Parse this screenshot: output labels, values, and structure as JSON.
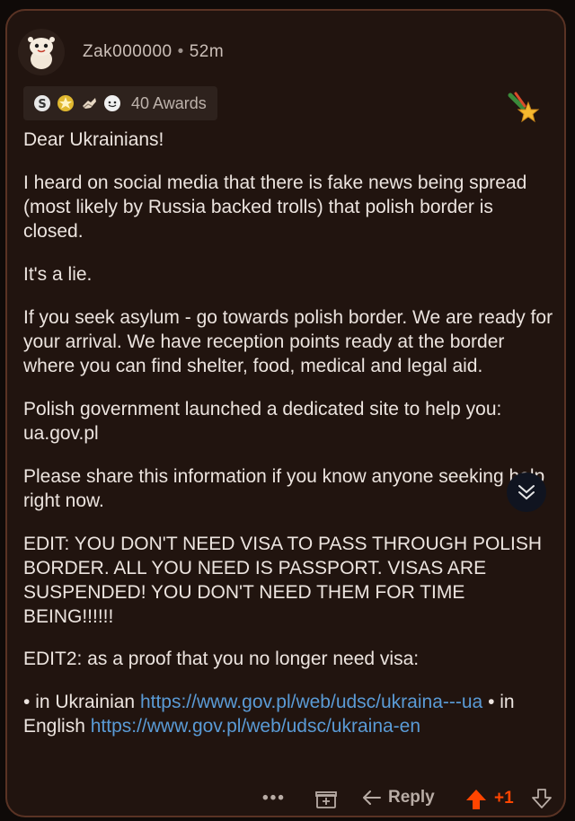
{
  "comment": {
    "username": "Zak000000",
    "separator": "•",
    "time": "52m",
    "awards_label": "40 Awards",
    "paragraphs": [
      "Dear Ukrainians!",
      "I heard on social media that there is fake news being spread (most likely by Russia backed trolls) that polish border is closed.",
      "It's a lie.",
      "If you seek asylum - go towards polish border. We are ready for your arrival. We have reception points ready at the border where you can find shelter, food, medical and legal aid.",
      "Polish government launched a dedicated site to help you: ua.gov.pl",
      "Please share this information if you know anyone seeking help right now.",
      "EDIT: YOU DON'T NEED VISA TO PASS THROUGH POLISH BORDER. ALL YOU NEED IS PASSPORT. VISAS ARE SUSPENDED! YOU DON'T NEED THEM FOR TIME BEING!!!!!!",
      "EDIT2: as a proof that you no longer need visa:"
    ],
    "links": {
      "bullet": "•",
      "ukrainian_label": "in Ukrainian",
      "ukrainian_url": "https://www.gov.pl/web/udsc/ukraina---ua",
      "english_label": "in English",
      "english_url": "https://www.gov.pl/web/udsc/ukraina-en"
    }
  },
  "actions": {
    "more": "•••",
    "reply": "Reply",
    "vote_count": "+1"
  },
  "colors": {
    "card_bg": "#21140f",
    "border": "#5a3324",
    "text": "#ece4df",
    "link": "#5a9bd6",
    "upvote": "#ff4500"
  },
  "icons": [
    "avatar-icon",
    "silver-award-icon",
    "gold-award-icon",
    "helping-hand-award-icon",
    "wholesome-award-icon",
    "favorite-star-icon",
    "collapse-chevron-icon",
    "gift-icon",
    "reply-icon",
    "upvote-icon",
    "downvote-icon"
  ]
}
